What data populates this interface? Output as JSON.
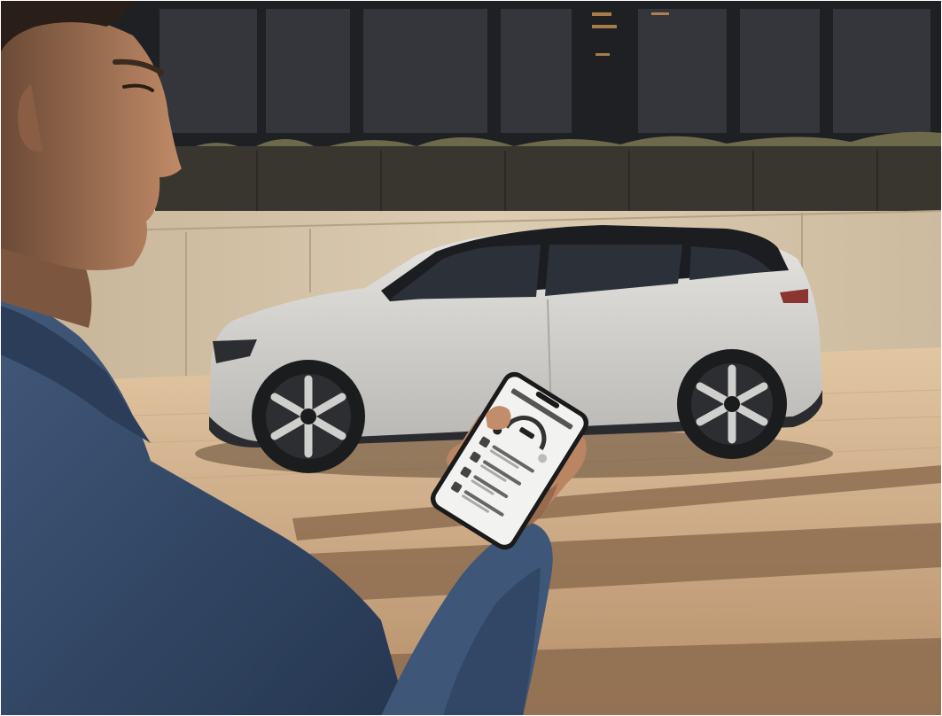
{
  "photo": {
    "subject": "man-holding-smartphone-beside-car",
    "colors": {
      "sky_dark": "#1a1a1c",
      "building_glass": "#2a2b2e",
      "wall_beige": "#d9c8ae",
      "wall_shadow": "#b8a68c",
      "pavement_light": "#d7b894",
      "pavement_dark": "#8e6f52",
      "car_body": "#d8d7d4",
      "car_roof": "#1c1d20",
      "car_window": "#2a2f36",
      "wheel_dark": "#1b1c1e",
      "rim_light": "#c9c9c7",
      "jacket_blue": "#3b5475",
      "jacket_shadow": "#22324a",
      "skin": "#b07d5c",
      "hair": "#2a1f18",
      "phone_frame": "#1a1a1a",
      "phone_screen": "#f2f2f0",
      "accent_dark": "#222222"
    }
  },
  "phone_ui": {
    "icons": [
      "gauge-icon",
      "charging-icon",
      "climate-icon",
      "location-icon",
      "lock-icon"
    ]
  }
}
